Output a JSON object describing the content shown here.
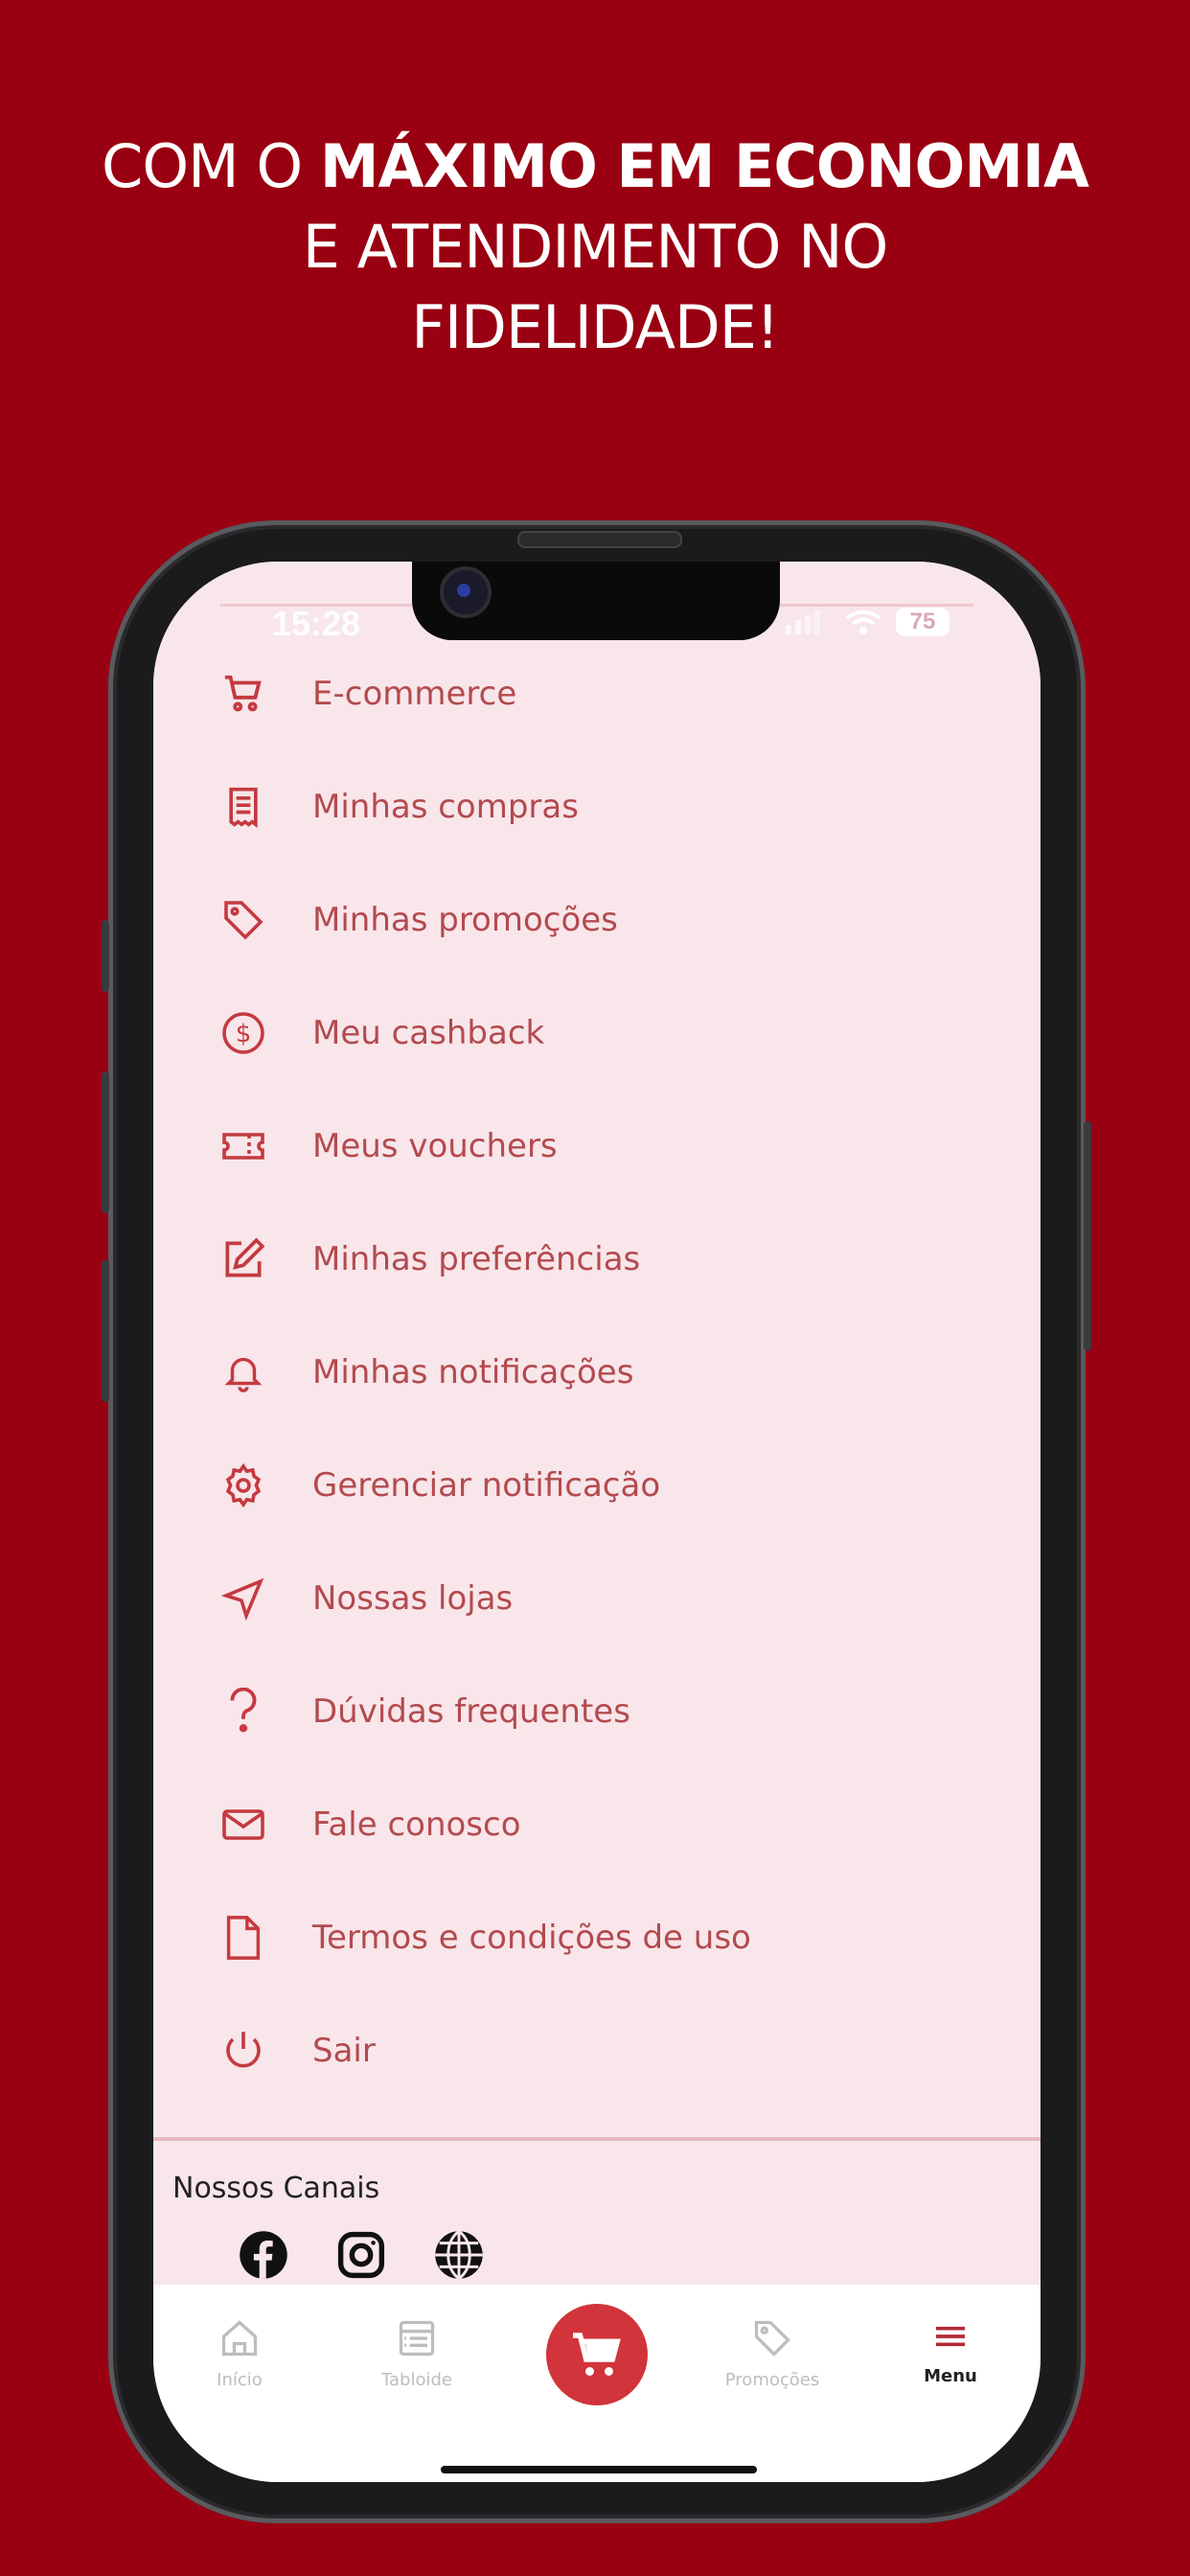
{
  "headline": {
    "line1_normal": "COM O ",
    "line1_bold": "MÁXIMO EM ECONOMIA",
    "line2": "E ATENDIMENTO NO",
    "line3": "FIDELIDADE!"
  },
  "status_bar": {
    "time": "15:28",
    "battery": "75"
  },
  "menu": {
    "items": [
      {
        "label": "E-commerce",
        "icon": "cart-icon"
      },
      {
        "label": "Minhas compras",
        "icon": "receipt-icon"
      },
      {
        "label": "Minhas promoções",
        "icon": "tag-icon"
      },
      {
        "label": "Meu cashback",
        "icon": "dollar-circle-icon"
      },
      {
        "label": "Meus vouchers",
        "icon": "ticket-icon"
      },
      {
        "label": "Minhas preferências",
        "icon": "edit-icon"
      },
      {
        "label": "Minhas notificações",
        "icon": "bell-icon"
      },
      {
        "label": "Gerenciar notificação",
        "icon": "gear-icon"
      },
      {
        "label": "Nossas lojas",
        "icon": "navigation-icon"
      },
      {
        "label": "Dúvidas frequentes",
        "icon": "question-icon"
      },
      {
        "label": "Fale conosco",
        "icon": "mail-icon"
      },
      {
        "label": "Termos e condições de uso",
        "icon": "document-icon"
      },
      {
        "label": "Sair",
        "icon": "power-icon"
      }
    ]
  },
  "channels": {
    "title": "Nossos Canais",
    "icons": [
      "facebook-icon",
      "instagram-icon",
      "globe-icon"
    ]
  },
  "bottom_nav": {
    "items": [
      {
        "label": "Início",
        "icon": "home-icon",
        "active": false
      },
      {
        "label": "Tabloide",
        "icon": "newspaper-icon",
        "active": false
      },
      {
        "label": "",
        "icon": "cart-icon",
        "active": false
      },
      {
        "label": "Promoções",
        "icon": "tag-icon",
        "active": false
      },
      {
        "label": "Menu",
        "icon": "hamburger-icon",
        "active": true
      }
    ]
  },
  "colors": {
    "background": "#990012",
    "menu_text": "#b34a4f",
    "menu_bg": "#f8e6ea",
    "fab": "#d1343a"
  }
}
